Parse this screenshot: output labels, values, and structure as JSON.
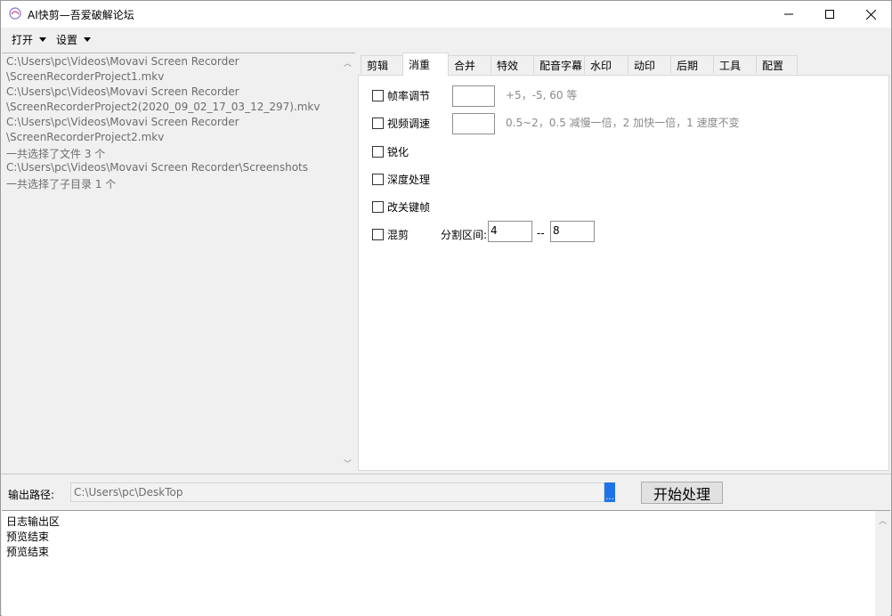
{
  "window": {
    "title": "AI快剪—吾爱破解论坛",
    "controls": [
      "minimize-icon",
      "maximize-icon",
      "close-icon"
    ]
  },
  "menubar": [
    {
      "label": "打开"
    },
    {
      "label": "设置"
    }
  ],
  "file_list": [
    "C:\\Users\\pc\\Videos\\Movavi Screen Recorder",
    "\\ScreenRecorderProject1.mkv",
    "C:\\Users\\pc\\Videos\\Movavi Screen Recorder",
    "\\ScreenRecorderProject2(2020_09_02_17_03_12_297).mkv",
    "C:\\Users\\pc\\Videos\\Movavi Screen Recorder",
    "\\ScreenRecorderProject2.mkv",
    "一共选择了文件 3 个",
    "C:\\Users\\pc\\Videos\\Movavi Screen Recorder\\Screenshots",
    "一共选择了子目录 1 个"
  ],
  "tabs": [
    "剪辑",
    "消重",
    "合并",
    "特效",
    "配音字幕",
    "水印",
    "动印",
    "后期",
    "工具",
    "配置"
  ],
  "active_tab": "消重",
  "options": {
    "frame_rate": {
      "label": "帧率调节",
      "value": "",
      "hint": "+5，-5, 60 等"
    },
    "speed": {
      "label": "视频调速",
      "value": "",
      "hint": "0.5~2，0.5 减慢一倍，2 加快一倍，1 速度不变"
    },
    "sharpen": {
      "label": "锐化"
    },
    "deep": {
      "label": "深度处理"
    },
    "keyframe": {
      "label": "改关键帧"
    },
    "mix": {
      "label": "混剪",
      "range_label": "分割区间:",
      "from": "4",
      "sep": "--",
      "to": "8"
    }
  },
  "output": {
    "label": "输出路径:",
    "path": "C:\\Users\\pc\\DeskTop",
    "browse": "...",
    "start": "开始处理"
  },
  "log": [
    "日志输出区",
    "预览结束",
    "预览结束"
  ]
}
